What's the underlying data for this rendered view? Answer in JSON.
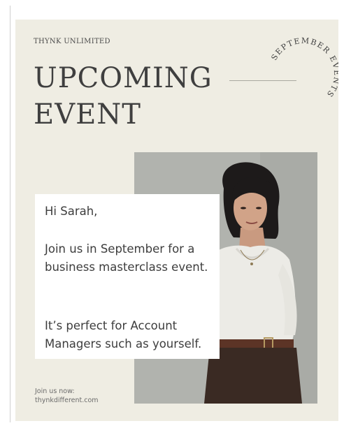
{
  "brand": "THYNK UNLIMITED",
  "headline": {
    "line1": "UPCOMING",
    "line2": "EVENT"
  },
  "badge": {
    "text": "SEPTEMBER EVENTS"
  },
  "message": {
    "greeting": "Hi Sarah,",
    "paragraph1": "Join us in September for a business masterclass event.",
    "paragraph2": "It’s perfect for Account Managers such as yourself."
  },
  "footer": {
    "line1": "Join us now:",
    "line2": "thynkdifferent.com"
  },
  "colors": {
    "background": "#efede3",
    "text": "#3f3f3f",
    "photo_backdrop": "#b2b4b0",
    "message_box": "#ffffff"
  }
}
